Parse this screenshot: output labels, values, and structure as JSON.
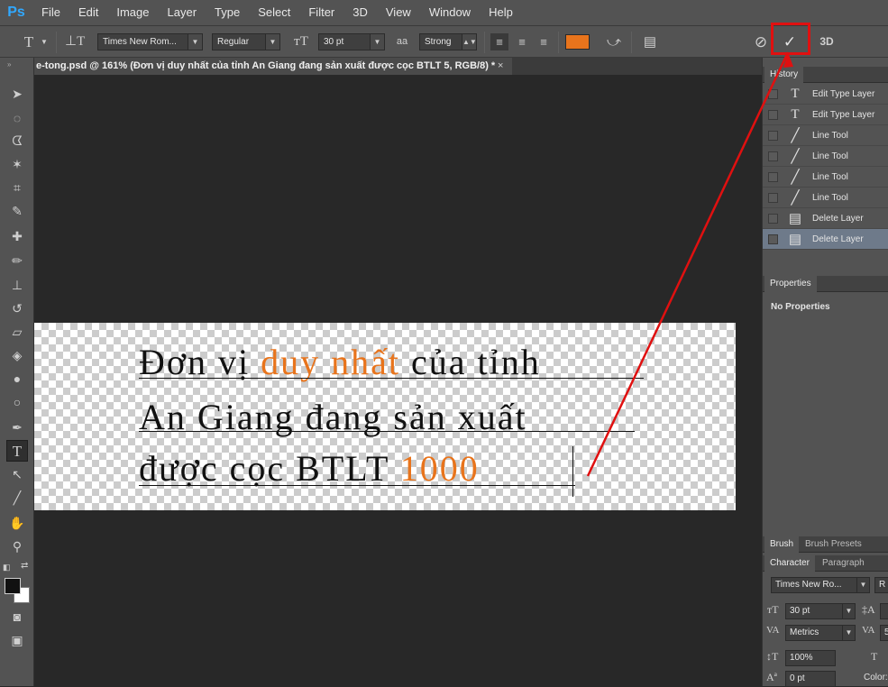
{
  "app": {
    "logo": "Ps"
  },
  "menu": [
    "File",
    "Edit",
    "Image",
    "Layer",
    "Type",
    "Select",
    "Filter",
    "3D",
    "View",
    "Window",
    "Help"
  ],
  "options": {
    "font_family": "Times New Rom...",
    "font_style": "Regular",
    "font_size": "30 pt",
    "antialias_icon_text": "aa",
    "antialias": "Strong",
    "text_color": "#e8741c",
    "three_d_label": "3D"
  },
  "document": {
    "tab_title": "e-tong.psd @ 161% (Đơn vị duy nhất của tỉnh An Giang đang sản xuất được cọc BTLT 5, RGB/8) *",
    "tab_close": "×",
    "lines": [
      {
        "parts": [
          "Đơn vị ",
          "duy nhất",
          " của tỉnh"
        ]
      },
      {
        "parts": [
          "An Giang đang sản xuất"
        ]
      },
      {
        "parts": [
          "được cọc BTLT ",
          "1000"
        ]
      }
    ]
  },
  "history": {
    "tab_label": "History",
    "items": [
      {
        "icon": "type-icon",
        "label": "Edit Type Layer"
      },
      {
        "icon": "type-icon",
        "label": "Edit Type Layer"
      },
      {
        "icon": "line-tool-icon",
        "label": "Line Tool"
      },
      {
        "icon": "line-tool-icon",
        "label": "Line Tool"
      },
      {
        "icon": "line-tool-icon",
        "label": "Line Tool"
      },
      {
        "icon": "line-tool-icon",
        "label": "Line Tool"
      },
      {
        "icon": "document-icon",
        "label": "Delete Layer"
      },
      {
        "icon": "document-icon",
        "label": "Delete Layer",
        "selected": true
      }
    ]
  },
  "properties": {
    "tab_label": "Properties",
    "empty_text": "No Properties"
  },
  "brush_tabs": [
    "Brush",
    "Brush Presets"
  ],
  "character": {
    "tabs": [
      "Character",
      "Paragraph"
    ],
    "font_family": "Times New Ro...",
    "font_style_initial": "R",
    "font_size": "30 pt",
    "kerning": "Metrics",
    "tracking_initial": "5",
    "vertical_scale": "100%",
    "baseline_shift": "0 pt",
    "color_label": "Color:"
  },
  "annotation": {
    "color": "#e01010"
  }
}
